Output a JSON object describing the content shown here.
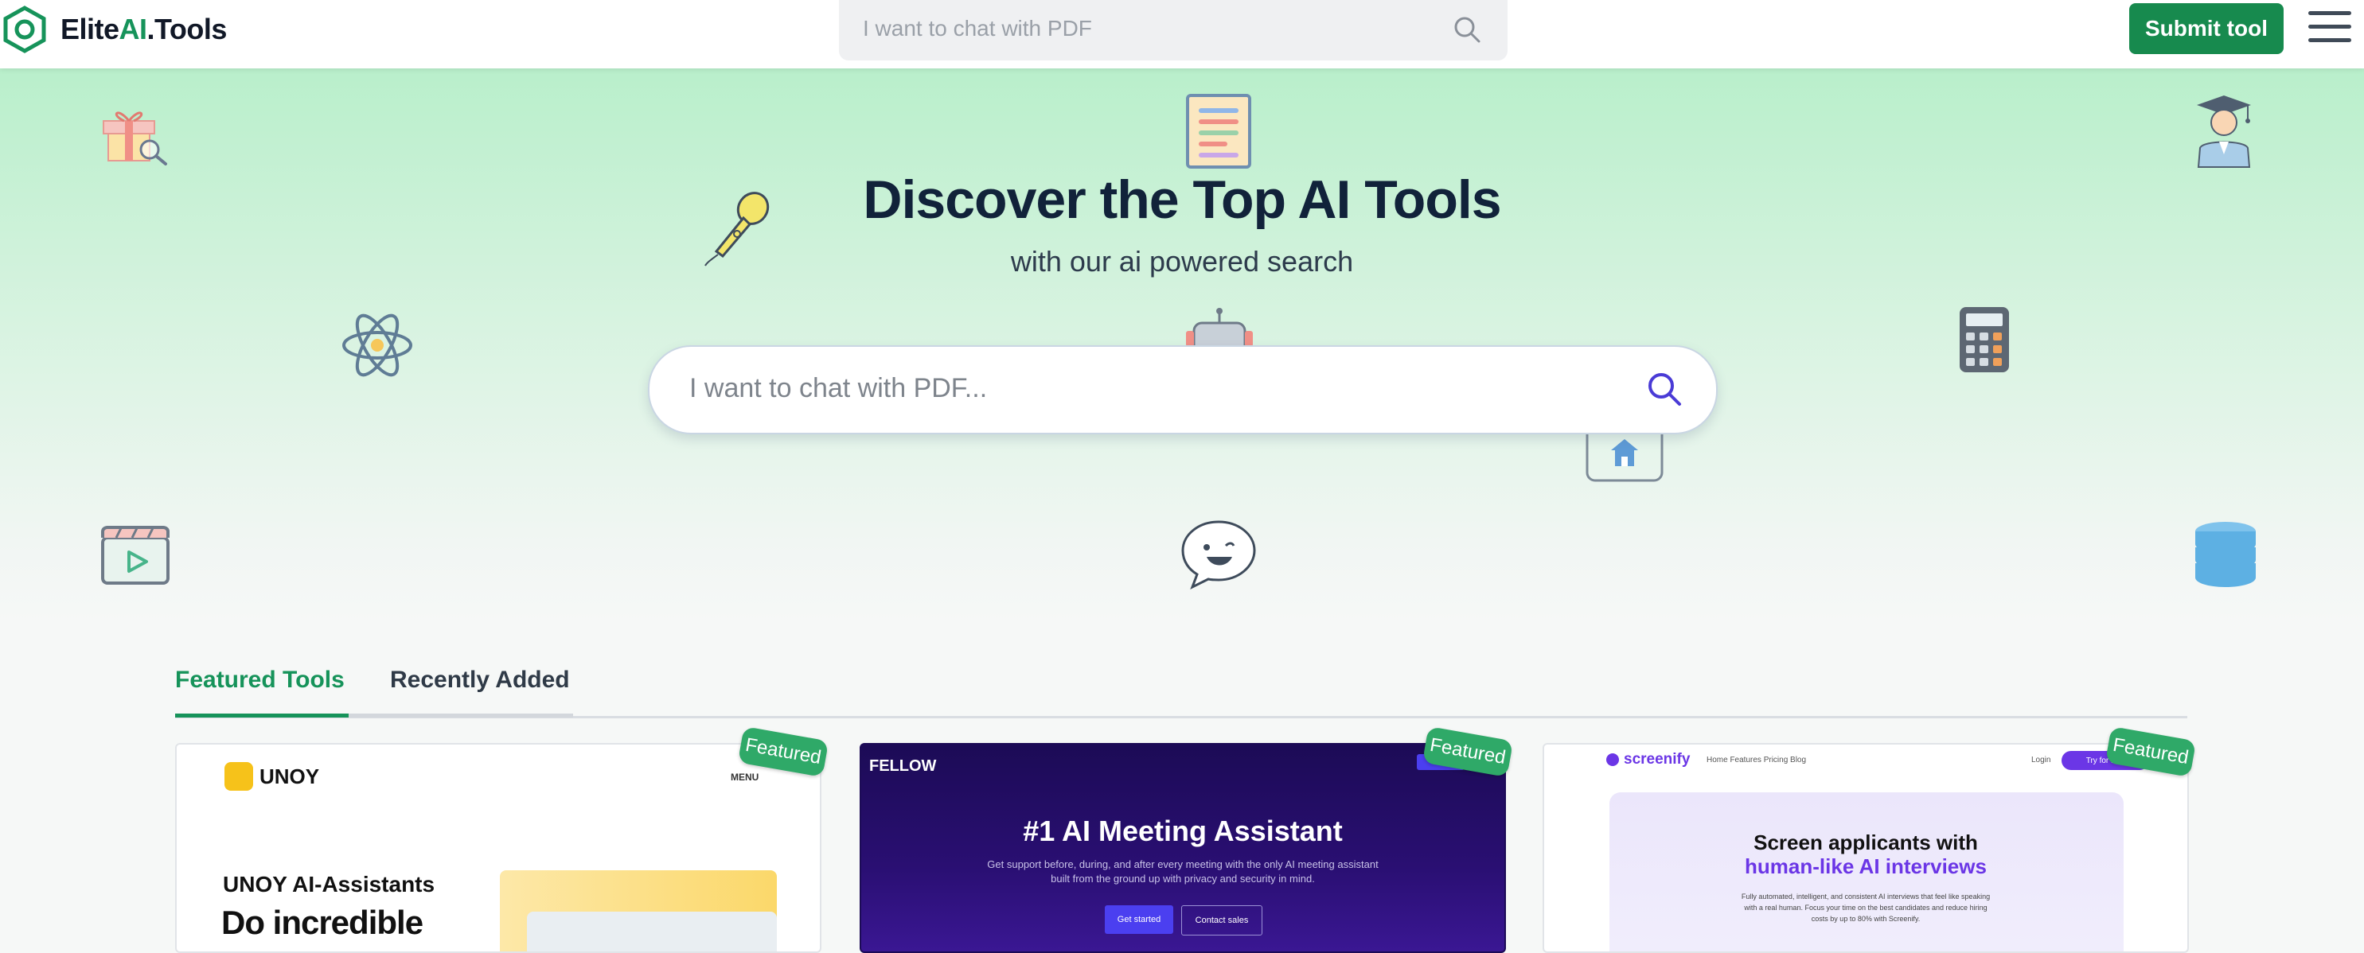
{
  "header": {
    "logo_part1": "Elite",
    "logo_part2": "AI",
    "logo_part3": ".Tools",
    "search_placeholder": "I want to chat with PDF",
    "submit_label": "Submit tool"
  },
  "hero": {
    "title": "Discover the Top AI Tools",
    "subtitle": "with our ai powered search",
    "search_placeholder": "I want to chat with PDF..."
  },
  "tabs": [
    {
      "label": "Featured Tools",
      "active": true
    },
    {
      "label": "Recently Added",
      "active": false
    }
  ],
  "cards": [
    {
      "badge": "Featured",
      "brand": "UNOY",
      "menu": "MENU",
      "headline": "UNOY AI-Assistants",
      "headline2": "Do incredible"
    },
    {
      "badge": "Featured",
      "brand": "FELLOW",
      "headline": "#1 AI Meeting Assistant",
      "text": "Get support before, during, and after every meeting with the only AI meeting assistant built from the ground up with privacy and security in mind.",
      "button1": "Get started",
      "button2": "Contact sales"
    },
    {
      "badge": "Featured",
      "brand": "screenify",
      "nav": "Home   Features   Pricing   Blog",
      "login": "Login",
      "try": "Try for free",
      "headline": "Screen applicants with",
      "headline2": "human-like AI interviews",
      "text": "Fully automated, intelligent, and consistent AI interviews that feel like speaking with a real human. Focus your time on the best candidates and reduce hiring costs by up to 80% with Screenify."
    }
  ],
  "colors": {
    "brand_green": "#178a4e",
    "accent_purple": "#6b36e6",
    "hero_green": "#b9efcb"
  }
}
